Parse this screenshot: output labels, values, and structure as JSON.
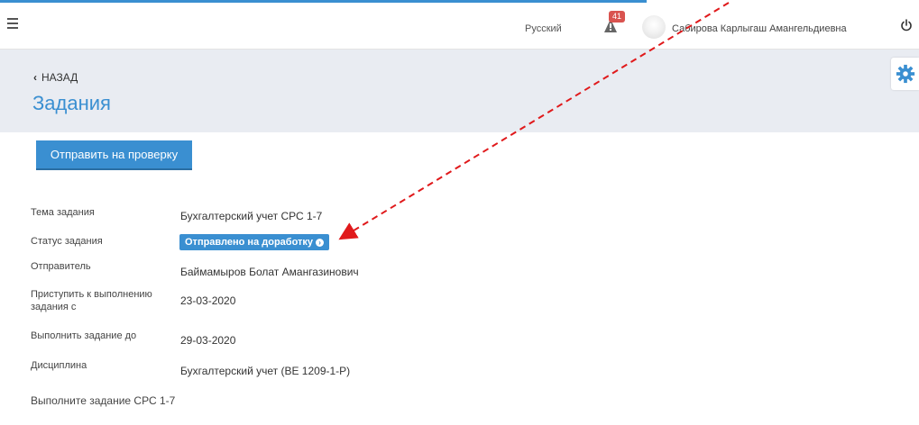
{
  "topbar": {
    "language": "Русский",
    "notifications_count": "41",
    "user_name": "Сабирова Карлыгаш Амангельдиевна"
  },
  "header": {
    "back_label": "НАЗАД",
    "title": "Задания"
  },
  "actions": {
    "send_for_review": "Отправить на проверку"
  },
  "task": {
    "topic_label": "Тема задания",
    "topic_value": "Бухгалтерский учет СРС 1-7",
    "status_label": "Статус задания",
    "status_value": "Отправлено на доработку",
    "sender_label": "Отправитель",
    "sender_value": "Баймамыров Болат Амангазинович",
    "start_label_1": "Приступить к выполнению",
    "start_label_2": "задания с",
    "start_value": "23-03-2020",
    "due_label": "Выполнить задание до",
    "due_value": "29-03-2020",
    "discipline_label": "Дисциплина",
    "discipline_value": "Бухгалтерский учет (BE 1209-1-P)",
    "instruction": "Выполните задание СРС 1-7"
  },
  "colors": {
    "accent": "#3a8fd1",
    "annotation_arrow": "#e0191b",
    "badge": "#d9534f"
  }
}
